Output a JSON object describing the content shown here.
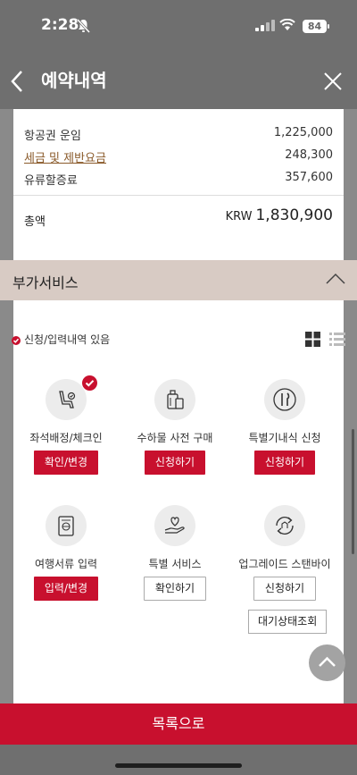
{
  "status_bar": {
    "time": "2:28",
    "battery": "84"
  },
  "header": {
    "title": "예약내역"
  },
  "fare": {
    "rows": [
      {
        "label": "항공권 운임",
        "value": "1,225,000"
      },
      {
        "label": "세금 및 제반요금",
        "value": "248,300"
      },
      {
        "label": "유류할증료",
        "value": "357,600"
      }
    ],
    "total_label": "총액",
    "total_currency": "KRW",
    "total_value": "1,830,900"
  },
  "addons": {
    "title": "부가서비스",
    "legend": "신청/입력내역 있음",
    "services": [
      {
        "label": "좌석배정/체크인",
        "button": "확인/변경",
        "icon": "seat-icon",
        "selected": true
      },
      {
        "label": "수하물 사전 구매",
        "button": "신청하기",
        "icon": "luggage-icon"
      },
      {
        "label": "특별기내식 신청",
        "button": "신청하기",
        "icon": "meal-icon"
      },
      {
        "label": "여행서류 입력",
        "button": "입력/변경",
        "icon": "passport-icon"
      },
      {
        "label": "특별 서비스",
        "button": "확인하기",
        "icon": "heart-hand-icon"
      },
      {
        "label": "업그레이드 스탠바이",
        "button": "신청하기",
        "icon": "upgrade-icon"
      }
    ],
    "waitlist_button": "대기상태조회"
  },
  "footer": {
    "list_button": "목록으로"
  },
  "colors": {
    "accent": "#c8102e",
    "section_bar": "#d8cbc4"
  }
}
